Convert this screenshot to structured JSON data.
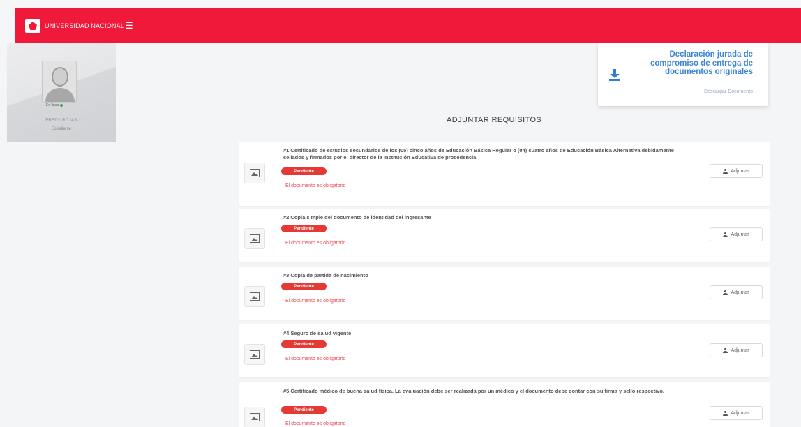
{
  "header": {
    "logo_text": "UNIVERSIDAD NACIONAL",
    "menu_icon": "hamburger-menu-icon"
  },
  "sidebar": {
    "status": "En línea",
    "user_name": "FREDY ROJAS",
    "user_role": "Estudiante"
  },
  "declaration": {
    "title": "Declaración jurada de compromiso de entrega de documentos originales",
    "link": "Descargar Documento",
    "icon": "download-icon"
  },
  "section": {
    "title": "ADJUNTAR REQUISITOS"
  },
  "requirements": [
    {
      "title": "#1 Certificado de estudios secundarios de los (05) cinco años de Educación Básica Regular o (04) cuatro años de Educación Básica Alternativa debidamente sellados y firmados por el director de la Institución Educativa de procedencia.",
      "status": "Pendiente",
      "note": "El documento es obligatorio",
      "button": "Adjuntar"
    },
    {
      "title": "#2 Copia simple del documento de identidad del ingresante",
      "status": "Pendiente",
      "note": "El documento es obligatorio",
      "button": "Adjuntar"
    },
    {
      "title": "#3 Copia de partida de nacimiento",
      "status": "Pendiente",
      "note": "El documento es obligatorio",
      "button": "Adjuntar"
    },
    {
      "title": "#4 Seguro de salud vigente",
      "status": "Pendiente",
      "note": "El documento es obligatorio",
      "button": "Adjuntar"
    },
    {
      "title": "#5 Certificado médico de buena salud física. La evaluación debe ser realizada por un médico y el documento debe contar con su firma y sello respectivo.",
      "status": "Pendiente",
      "note": "El documento es obligatorio",
      "button": "Adjuntar"
    }
  ],
  "colors": {
    "brand_red": "#f1193a",
    "accent_blue": "#3d86d6",
    "badge_red": "#e53935"
  }
}
